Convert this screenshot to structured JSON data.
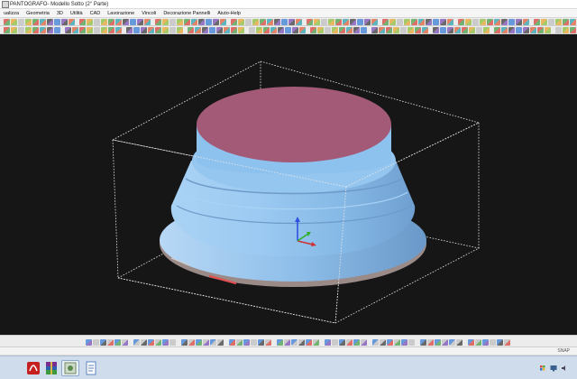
{
  "window": {
    "title": "PANTOGRAFO- Modello Sotto (2° Parte)"
  },
  "menu": {
    "items": [
      "ualizza",
      "Geometria",
      "3D",
      "Utilità",
      "CAD",
      "Lavorazione",
      "Vincoli",
      "Decorazione Pannelli",
      "Aiuto-Help"
    ]
  },
  "viewport": {
    "background_color": "#161616",
    "model": {
      "top_face_color": "#a35a76",
      "body_color": "#8fc3ee",
      "base_color": "#9a8a88",
      "highlight_color": "#e05050"
    },
    "bounding_box_style": "dotted-white",
    "axis_triad": {
      "x_color": "#d03030",
      "y_color": "#30b030",
      "z_color": "#3050e0"
    }
  },
  "statusbar": {
    "snap_label": "SNAP"
  },
  "taskbar": {
    "apps": [
      {
        "icon": "acrobat-icon"
      },
      {
        "icon": "winrar-icon"
      },
      {
        "icon": "cad-app-icon"
      },
      {
        "icon": "document-icon"
      }
    ],
    "tray_icons": [
      "flag-icon",
      "monitor-icon",
      "speaker-icon"
    ]
  }
}
